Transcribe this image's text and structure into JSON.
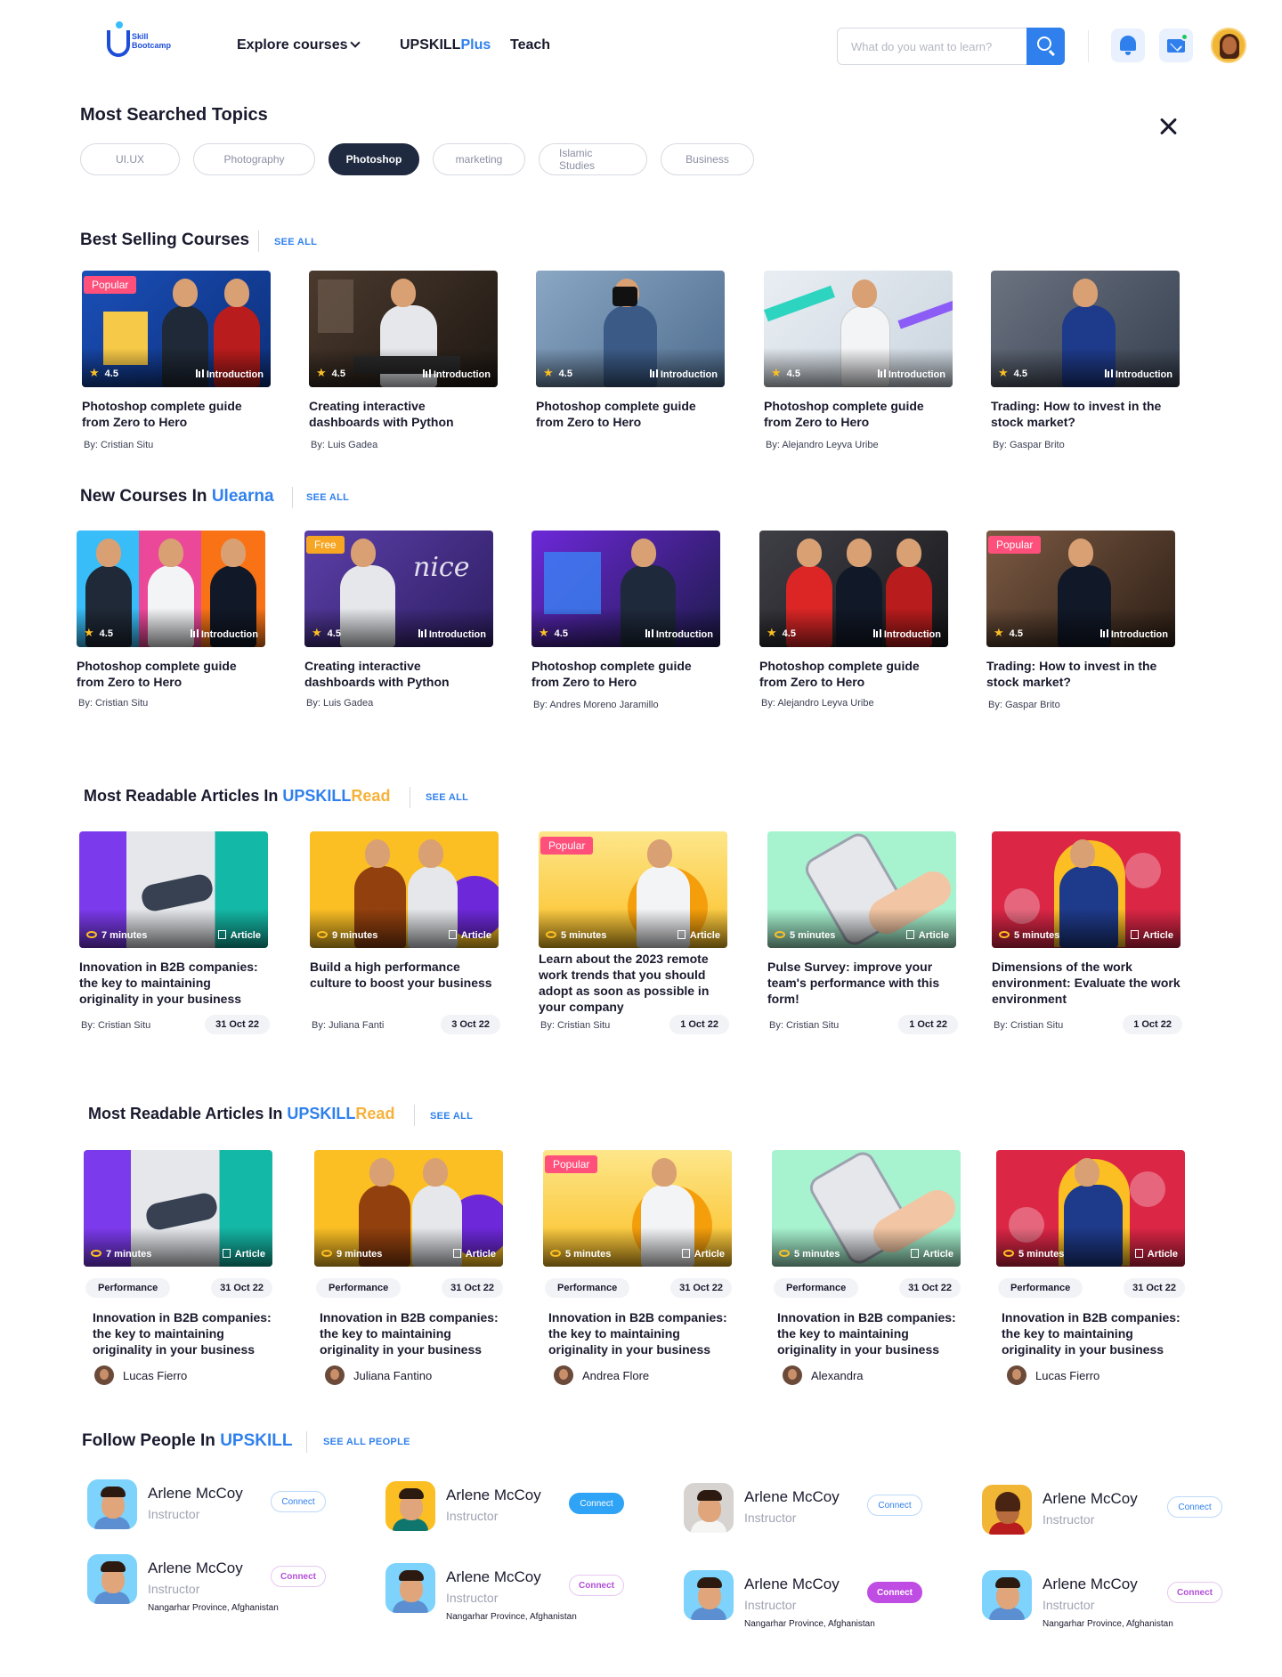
{
  "header": {
    "logo_text_1": "Skill",
    "logo_text_2": "Bootcamp",
    "nav_explore": "Explore courses",
    "nav_upskill": "UPSKILL",
    "nav_upskill_plus": "Plus",
    "nav_teach": "Teach",
    "search_placeholder": "What do you want to learn?",
    "icons": [
      "search-icon",
      "bell-icon",
      "mail-icon",
      "user-avatar"
    ]
  },
  "topics": {
    "title": "Most Searched Topics",
    "chips": [
      "UI.UX",
      "Photography",
      "Photoshop",
      "marketing",
      "Islamic Studies",
      "Business"
    ],
    "active": "Photoshop"
  },
  "best_selling": {
    "title": "Best Selling Courses",
    "see_all": "SEE ALL",
    "cards": [
      {
        "badge": "Popular",
        "rating": "4.5",
        "tag": "Introduction",
        "title": "Photoshop complete guide from Zero to Hero",
        "by": "By: Cristian Situ"
      },
      {
        "badge": "",
        "rating": "4.5",
        "tag": "Introduction",
        "title": "Creating interactive dashboards with Python",
        "by": "By: Luis Gadea"
      },
      {
        "badge": "",
        "rating": "4.5",
        "tag": "Introduction",
        "title": "Photoshop complete guide from Zero to Hero",
        "by": ""
      },
      {
        "badge": "",
        "rating": "4.5",
        "tag": "Introduction",
        "title": "Photoshop complete guide from Zero to Hero",
        "by": "By: Alejandro Leyva Uribe"
      },
      {
        "badge": "",
        "rating": "4.5",
        "tag": "Introduction",
        "title": "Trading: How to invest in the stock market?",
        "by": "By: Gaspar Brito"
      }
    ]
  },
  "new_courses": {
    "title": "New Courses In ",
    "title_accent": "Ulearna",
    "see_all": "SEE ALL",
    "cards": [
      {
        "badge": "",
        "rating": "4.5",
        "tag": "Introduction",
        "title": "Photoshop complete guide from Zero to Hero",
        "by": "By: Cristian Situ"
      },
      {
        "badge": "Free",
        "rating": "4.5",
        "tag": "Introduction",
        "title": "Creating interactive dashboards with Python",
        "by": "By: Luis Gadea"
      },
      {
        "badge": "",
        "rating": "4.5",
        "tag": "Introduction",
        "title": "Photoshop complete guide from Zero to Hero",
        "by": "By: Andres Moreno Jaramillo"
      },
      {
        "badge": "",
        "rating": "4.5",
        "tag": "Introduction",
        "title": "Photoshop complete guide from Zero to Hero",
        "by": "By: Alejandro Leyva Uribe"
      },
      {
        "badge": "Popular",
        "rating": "4.5",
        "tag": "Introduction",
        "title": "Trading: How to invest in the stock market?",
        "by": "By: Gaspar Brito"
      }
    ]
  },
  "articles_1": {
    "title": "Most Readable Articles In ",
    "title_accent_1": "UPSKILL",
    "title_accent_2": "Read",
    "see_all": "SEE ALL",
    "cards": [
      {
        "badge": "",
        "time": "7 minutes",
        "tag": "Article",
        "title": "Innovation in B2B companies: the key to maintaining originality in your business",
        "by": "By: Cristian Situ",
        "date": "31 Oct 22"
      },
      {
        "badge": "",
        "time": "9 minutes",
        "tag": "Article",
        "title": "Build a high performance culture to boost your business",
        "by": "By: Juliana Fanti",
        "date": "3 Oct 22"
      },
      {
        "badge": "Popular",
        "time": "5 minutes",
        "tag": "Article",
        "title": "Learn about the 2023 remote work trends that you should adopt as soon as possible in your company",
        "by": "By: Cristian Situ",
        "date": "1 Oct 22"
      },
      {
        "badge": "",
        "time": "5 minutes",
        "tag": "Article",
        "title": "Pulse Survey: improve your team's performance with this form!",
        "by": "By: Cristian Situ",
        "date": "1 Oct 22"
      },
      {
        "badge": "",
        "time": "5 minutes",
        "tag": "Article",
        "title": "Dimensions of the work environment: Evaluate the work environment",
        "by": "By: Cristian Situ",
        "date": "1 Oct 22"
      }
    ]
  },
  "articles_2": {
    "title": "Most Readable Articles In ",
    "title_accent_1": "UPSKILL",
    "title_accent_2": "Read",
    "see_all": "SEE ALL",
    "cards": [
      {
        "badge": "",
        "time": "7 minutes",
        "tag": "Article",
        "category": "Performance",
        "date": "31 Oct 22",
        "title": "Innovation in B2B companies: the key to maintaining originality in your business",
        "author": "Lucas Fierro"
      },
      {
        "badge": "",
        "time": "9 minutes",
        "tag": "Article",
        "category": "Performance",
        "date": "31 Oct 22",
        "title": "Innovation in B2B companies: the key to maintaining originality in your business",
        "author": "Juliana Fantino"
      },
      {
        "badge": "Popular",
        "time": "5 minutes",
        "tag": "Article",
        "category": "Performance",
        "date": "31 Oct 22",
        "title": "Innovation in B2B companies: the key to maintaining originality in your business",
        "author": "Andrea Flore"
      },
      {
        "badge": "",
        "time": "5 minutes",
        "tag": "Article",
        "category": "Performance",
        "date": "31 Oct 22",
        "title": "Innovation in B2B companies: the key to maintaining originality in your business",
        "author": "Alexandra"
      },
      {
        "badge": "",
        "time": "5 minutes",
        "tag": "Article",
        "category": "Performance",
        "date": "31 Oct 22",
        "title": "Innovation in B2B companies: the key to maintaining originality in your business",
        "author": "Lucas Fierro"
      }
    ]
  },
  "people": {
    "title": "Follow People In ",
    "title_accent": "UPSKILL",
    "see_all": "SEE ALL PEOPLE",
    "rows": [
      [
        {
          "name": "Arlene McCoy",
          "role": "Instructor",
          "location": "",
          "button": "Connect"
        },
        {
          "name": "Arlene McCoy",
          "role": "Instructor",
          "location": "",
          "button": "Connect"
        },
        {
          "name": "Arlene McCoy",
          "role": "Instructor",
          "location": "",
          "button": "Connect"
        },
        {
          "name": "Arlene McCoy",
          "role": "Instructor",
          "location": "",
          "button": "Connect"
        }
      ],
      [
        {
          "name": "Arlene McCoy",
          "role": "Instructor",
          "location": "Nangarhar Province, Afghanistan",
          "button": "Connect"
        },
        {
          "name": "Arlene McCoy",
          "role": "Instructor",
          "location": "Nangarhar Province, Afghanistan",
          "button": "Connect"
        },
        {
          "name": "Arlene McCoy",
          "role": "Instructor",
          "location": "Nangarhar Province, Afghanistan",
          "button": "Connect"
        },
        {
          "name": "Arlene McCoy",
          "role": "Instructor",
          "location": "Nangarhar Province, Afghanistan",
          "button": "Connect"
        }
      ]
    ]
  },
  "colors": {
    "accent": "#2f80ed",
    "gold": "#f5b23b",
    "popular": "#ff4f7b",
    "free": "#f6a623",
    "dark_chip": "#1f2940"
  }
}
